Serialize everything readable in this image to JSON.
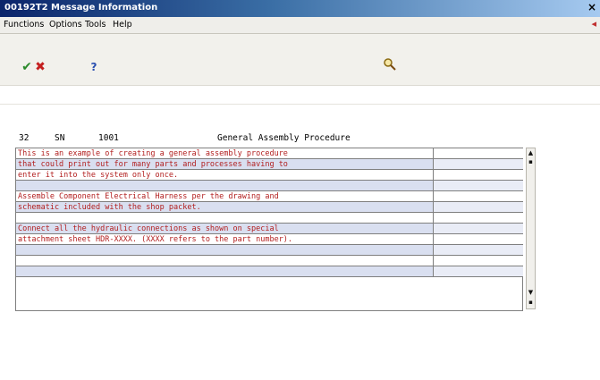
{
  "window": {
    "title": "00192T2  Message Information",
    "close_label": "×"
  },
  "menu": {
    "items": [
      {
        "label": "Functions"
      },
      {
        "label": "Options"
      },
      {
        "label": "Tools"
      },
      {
        "label": "Help"
      }
    ]
  },
  "toolbar": {
    "ok_icon": "checkmark-icon",
    "cancel_icon": "x-cancel-icon",
    "help_icon": "question-icon",
    "search_icon": "magnifier-search-icon",
    "ok_glyph": "✔",
    "cancel_glyph": "✖",
    "help_glyph": "?"
  },
  "header": {
    "code1": "32",
    "code2": "SN",
    "number": "1001",
    "title": "General Assembly Procedure"
  },
  "grid": {
    "rows": [
      "This is an example of creating a general assembly procedure",
      "that could print out for many parts and processes having to",
      "enter it into the system only once.",
      "",
      "Assemble Component Electrical Harness per the drawing and",
      "schematic included with the shop packet.",
      "",
      "Connect all the hydraulic connections as shown on special",
      "attachment sheet HDR-XXXX. (XXXX refers to the part number).",
      "",
      "",
      ""
    ]
  },
  "colors": {
    "text_red": "#b21e1e",
    "row_alt": "#d9dff0",
    "title_dark": "#0a246a"
  }
}
